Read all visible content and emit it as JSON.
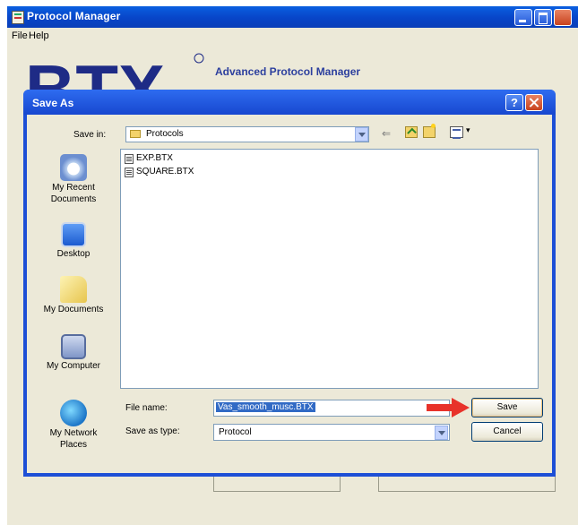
{
  "app": {
    "title": "Protocol Manager",
    "menu": [
      "File",
      "Help"
    ],
    "heading": "Advanced Protocol Manager",
    "logo_text": "BTX"
  },
  "dialog": {
    "title": "Save As",
    "help_label": "?",
    "save_in_label": "Save in:",
    "save_in_value": "Protocols",
    "places": [
      {
        "label_line1": "My Recent",
        "label_line2": "Documents",
        "icon": "recent-documents-icon"
      },
      {
        "label_line1": "Desktop",
        "label_line2": "",
        "icon": "desktop-icon"
      },
      {
        "label_line1": "My Documents",
        "label_line2": "",
        "icon": "my-documents-icon"
      },
      {
        "label_line1": "My Computer",
        "label_line2": "",
        "icon": "my-computer-icon"
      },
      {
        "label_line1": "My Network",
        "label_line2": "Places",
        "icon": "network-places-icon"
      }
    ],
    "files": [
      {
        "name": "EXP.BTX",
        "icon": "file-icon"
      },
      {
        "name": "SQUARE.BTX",
        "icon": "file-icon"
      }
    ],
    "file_name_label": "File name:",
    "file_name_value": "Vas_smooth_musc.BTX",
    "save_type_label": "Save as type:",
    "save_type_value": "Protocol",
    "save_button": "Save",
    "cancel_button": "Cancel"
  },
  "colors": {
    "dialog_frame": "#1d4fd6",
    "title_bar": "#0845c8",
    "window_bg": "#ece9d8",
    "highlight": "#316ac5",
    "pointer_arrow": "#e8322a",
    "heading_text": "#2c3f9e"
  }
}
